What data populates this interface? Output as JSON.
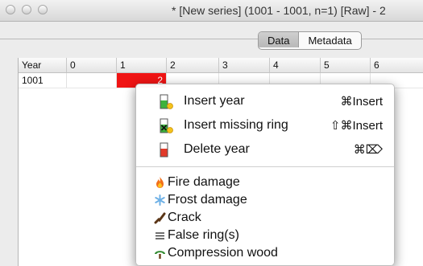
{
  "window": {
    "title": "* [New series] (1001 - 1001, n=1) [Raw] - 2"
  },
  "tabs": [
    {
      "label": "Data",
      "active": true
    },
    {
      "label": "Metadata",
      "active": false
    }
  ],
  "grid": {
    "headers": [
      "Year",
      "0",
      "1",
      "2",
      "3",
      "4",
      "5",
      "6"
    ],
    "rows": [
      {
        "year": "1001",
        "selected_value": "2"
      }
    ],
    "selection_color": "#f01414"
  },
  "context_menu": {
    "items": [
      {
        "label": "Insert year",
        "shortcut": "⌘Insert",
        "icon": "insert-year-icon"
      },
      {
        "label": "Insert missing ring",
        "shortcut": "⇧⌘Insert",
        "icon": "insert-missing-ring-icon"
      },
      {
        "label": "Delete year",
        "shortcut": "⌘⌦",
        "icon": "delete-year-icon"
      }
    ],
    "remarks": [
      {
        "label": "Fire damage",
        "icon": "fire-icon"
      },
      {
        "label": "Frost damage",
        "icon": "frost-icon"
      },
      {
        "label": "Crack",
        "icon": "crack-icon"
      },
      {
        "label": "False ring(s)",
        "icon": "false-ring-icon"
      },
      {
        "label": "Compression wood",
        "icon": "compression-wood-icon"
      }
    ]
  }
}
